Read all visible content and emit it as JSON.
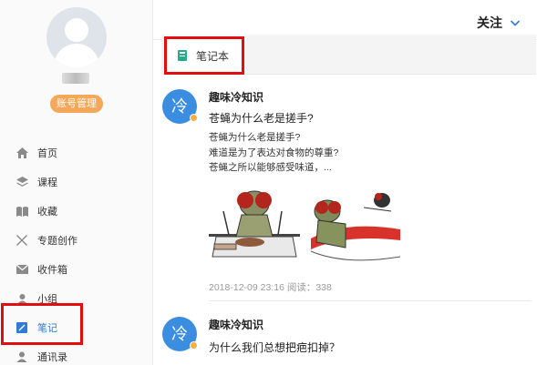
{
  "sidebar": {
    "account_button": "账号管理",
    "menu": [
      {
        "label": "首页",
        "icon": "home-icon"
      },
      {
        "label": "课程",
        "icon": "layers-icon"
      },
      {
        "label": "收藏",
        "icon": "book-icon"
      },
      {
        "label": "专题创作",
        "icon": "tools-icon"
      },
      {
        "label": "收件箱",
        "icon": "mail-icon"
      },
      {
        "label": "小组",
        "icon": "group-icon"
      },
      {
        "label": "笔记",
        "icon": "note-icon"
      },
      {
        "label": "通讯录",
        "icon": "contacts-icon"
      }
    ],
    "active_item": "笔记"
  },
  "header": {
    "follow_label": "关注"
  },
  "subnav": {
    "notebook_label": "笔记本"
  },
  "feed": [
    {
      "avatar_char": "冷",
      "author": "趣味冷知识",
      "title": "苍蝇为什么老是搓手?",
      "body_lines": [
        "苍蝇为什么老是搓手?",
        "难道是为了表达对食物的尊重?",
        "苍蝇之所以能够感受味道，..."
      ],
      "date": "2018-12-09 23:16",
      "read_label": "阅读：",
      "read_count": "338"
    },
    {
      "avatar_char": "冷",
      "author": "趣味冷知识",
      "title": "为什么我们总想把疤扣掉？"
    }
  ],
  "colors": {
    "accent": "#2f7bd6",
    "highlight": "#e10e0e",
    "account_button": "#f5a75a",
    "avatar_blue": "#3b8de0"
  }
}
